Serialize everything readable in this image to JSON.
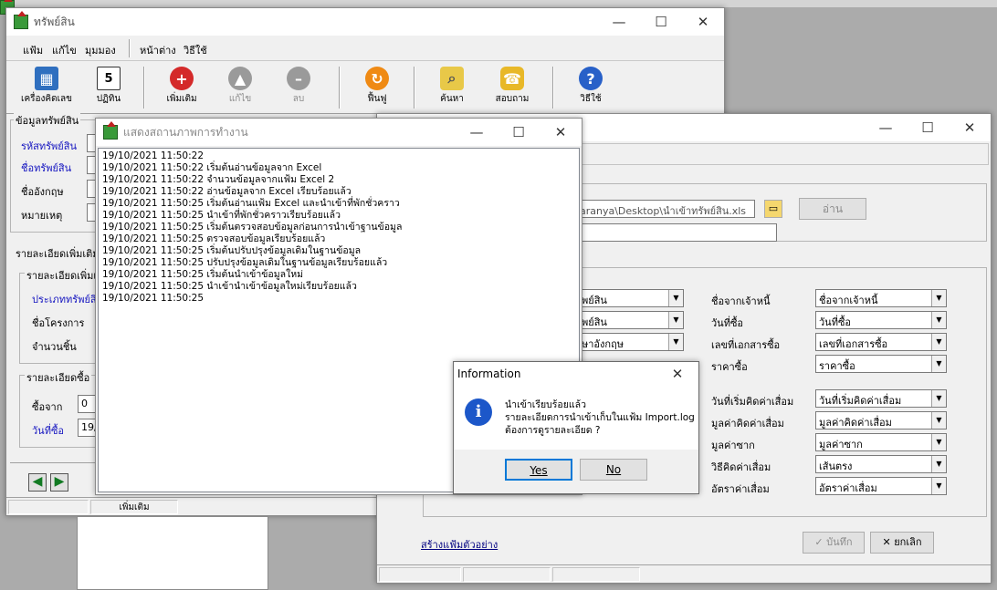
{
  "main_window": {
    "title": "ทรัพย์สิน",
    "menu": [
      "แฟ้ม",
      "แก้ไข",
      "มุมมอง",
      "หน้าต่าง",
      "วิธีใช้"
    ],
    "toolbar": [
      {
        "label": "เครื่องคิดเลข",
        "icon": "calculator-icon"
      },
      {
        "label": "ปฏิทิน",
        "icon": "calendar-icon"
      },
      {
        "label": "เพิ่มเติม",
        "icon": "add-icon"
      },
      {
        "label": "แก้ไข",
        "icon": "edit-icon"
      },
      {
        "label": "ลบ",
        "icon": "delete-icon"
      },
      {
        "label": "ฟื้นฟู",
        "icon": "restore-icon"
      },
      {
        "label": "ค้นหา",
        "icon": "search-icon"
      },
      {
        "label": "สอบถาม",
        "icon": "phone-icon"
      },
      {
        "label": "วิธีใช้",
        "icon": "help-icon"
      }
    ],
    "asset_group": {
      "title": "ข้อมูลทรัพย์สิน",
      "code_label": "รหัสทรัพย์สิน",
      "name_label": "ชื่อทรัพย์สิน",
      "eng_label": "ชื่ออังกฤษ",
      "note_label": "หมายเหตุ"
    },
    "extra_tab": "รายละเอียดเพิ่มเติม",
    "extra_group": {
      "title": "รายละเอียดเพิ่มเติ",
      "type_label": "ประเภททรัพย์สิ",
      "project_label": "ชื่อโครงการ",
      "qty_label": "จำนวนชิ้น"
    },
    "buy_group": {
      "title": "รายละเอียดซื้อ",
      "from_label": "ซื้อจาก",
      "from_value": "0",
      "date_label": "วันที่ซื้อ",
      "date_value": "19/"
    },
    "status_text": "เพิ่มเติม"
  },
  "log_window": {
    "title": "แสดงสถานภาพการทำงาน",
    "lines": [
      "19/10/2021 11:50:22",
      "19/10/2021 11:50:22 เริ่มต้นอ่านข้อมูลจาก Excel",
      "19/10/2021 11:50:22 จำนวนข้อมูลจากแฟ้ม Excel 2",
      "19/10/2021 11:50:22 อ่านข้อมูลจาก Excel เรียบร้อยแล้ว",
      "19/10/2021 11:50:25 เริ่มต้นอ่านแฟ้ม Excel และนำเข้าที่พักชั่วคราว",
      "19/10/2021 11:50:25 นำเข้าที่พักชั่วคราวเรียบร้อยแล้ว",
      "19/10/2021 11:50:25 เริ่มต้นตรวจสอบข้อมูลก่อนการนำเข้าฐานข้อมูล",
      "19/10/2021 11:50:25 ตรวจสอบข้อมูลเรียบร้อยแล้ว",
      "19/10/2021 11:50:25 เริ่มต้นปรับปรุงข้อมูลเดิมในฐานข้อมูล",
      "19/10/2021 11:50:25 ปรับปรุงข้อมูลเดิมในฐานข้อมูลเรียบร้อยแล้ว",
      "19/10/2021 11:50:25 เริ่มต้นนำเข้าข้อมูลใหม่",
      "19/10/2021 11:50:25 นำเข้านำเข้าข้อมูลใหม่เรียบร้อยแล้ว",
      "19/10/2021 11:50:25"
    ]
  },
  "import_window": {
    "file_path": "aranya\\Desktop\\นำเข้าทรัพย์สิน.xls",
    "read_button": "อ่าน",
    "left_combos": [
      "พย์สิน",
      "พย์สิน",
      "ษาอังกฤษ"
    ],
    "right_rows": [
      {
        "label": "ชื่อจากเจ้าหนี้",
        "value": "ชื่อจากเจ้าหนี้"
      },
      {
        "label": "วันที่ซื้อ",
        "value": "วันที่ซื้อ"
      },
      {
        "label": "เลขที่เอกสารซื้อ",
        "value": "เลขที่เอกสารซื้อ"
      },
      {
        "label": "ราคาซื้อ",
        "value": "ราคาซื้อ"
      },
      {
        "label": "วันที่เริ่มคิดค่าเสื่อม",
        "value": "วันที่เริ่มคิดค่าเสื่อม"
      },
      {
        "label": "มูลค่าคิดค่าเสื่อม",
        "value": "มูลค่าคิดค่าเสื่อม"
      },
      {
        "label": "มูลค่าซาก",
        "value": "มูลค่าซาก"
      },
      {
        "label": "วิธีคิดค่าเสื่อม",
        "value": "เส้นตรง"
      },
      {
        "label": "อัตราค่าเสื่อม",
        "value": "อัตราค่าเสื่อม"
      }
    ],
    "sample_link": "สร้างแฟ้มตัวอย่าง",
    "save_button": "บันทึก",
    "cancel_button": "ยกเลิก"
  },
  "dialog": {
    "title": "Information",
    "line1": "นำเข้าเรียบร้อยแล้ว",
    "line2": "รายละเอียดการนำเข้าเก็บในแฟ้ม Import.log",
    "line3": "ต้องการดูรายละเอียด ?",
    "yes": "Yes",
    "no": "No"
  },
  "window_controls": {
    "minimize": "—",
    "maximize": "☐",
    "close": "✕"
  },
  "colors": {
    "accent_blue": "#1515c0",
    "info_icon": "#1c57c9"
  }
}
